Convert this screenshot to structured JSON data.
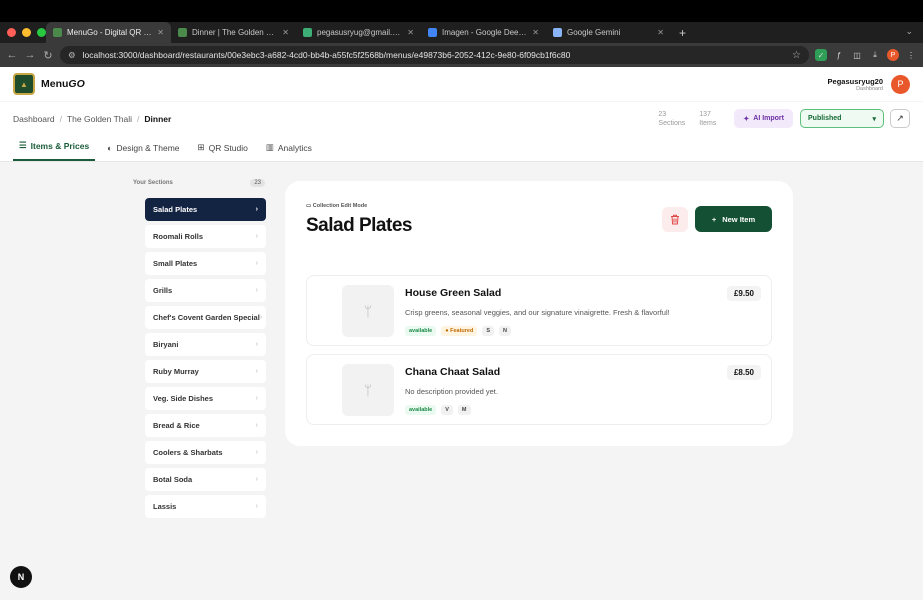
{
  "browser": {
    "tabs": [
      {
        "title": "MenuGo - Digital QR Code M",
        "active": true,
        "color": "#4b8a4b"
      },
      {
        "title": "Dinner | The Golden Thali - M",
        "active": false,
        "color": "#4b8a4b"
      },
      {
        "title": "pegasusryug@gmail.com's P",
        "active": false,
        "color": "#3cae76"
      },
      {
        "title": "Imagen - Google DeepMind",
        "active": false,
        "color": "#4285f4"
      },
      {
        "title": "Google Gemini",
        "active": false,
        "color": "#8ab4f8"
      }
    ],
    "url": "localhost:3000/dashboard/restaurants/00e3ebc3-a682-4cd0-bb4b-a55fc5f2568b/menus/e49873b6-2052-412c-9e80-6f09cb1f6c80",
    "profile_initial": "P"
  },
  "header": {
    "brand": "Menu",
    "brand_italic": "GO",
    "user_name": "Pegasusryug20",
    "user_sub": "Dashboard",
    "avatar_initial": "P"
  },
  "breadcrumb": {
    "items": [
      "Dashboard",
      "The Golden Thali"
    ],
    "current": "Dinner"
  },
  "stats": {
    "sections_count": "23",
    "sections_label": "Sections",
    "items_count": "137",
    "items_label": "Items"
  },
  "actions": {
    "ai_import": "AI Import",
    "status": "Published"
  },
  "nav_tabs": [
    {
      "label": "Items & Prices",
      "icon": "list-icon",
      "active": true
    },
    {
      "label": "Design & Theme",
      "icon": "palette-icon",
      "active": false
    },
    {
      "label": "QR Studio",
      "icon": "qr-icon",
      "active": false
    },
    {
      "label": "Analytics",
      "icon": "bar-chart-icon",
      "active": false
    }
  ],
  "sidebar": {
    "title": "Your Sections",
    "count": "23",
    "sections": [
      "Salad Plates",
      "Roomali Rolls",
      "Small Plates",
      "Grills",
      "Chef's Covent Garden Special",
      "Biryani",
      "Ruby Murray",
      "Veg. Side Dishes",
      "Bread & Rice",
      "Coolers & Sharbats",
      "Botal Soda",
      "Lassis"
    ],
    "active_index": 0
  },
  "collection": {
    "mode_label": "Collection Edit Mode",
    "title": "Salad Plates",
    "new_item_label": "New Item",
    "items": [
      {
        "name": "House Green Salad",
        "description": "Crisp greens, seasonal veggies, and our signature vinaigrette. Fresh & flavorful!",
        "price": "£9.50",
        "tags": [
          "available",
          "Featured",
          "S",
          "N"
        ]
      },
      {
        "name": "Chana Chaat Salad",
        "description": "No description provided yet.",
        "price": "£8.50",
        "tags": [
          "available",
          "V",
          "M"
        ]
      }
    ]
  },
  "footer": {
    "badge": "N"
  }
}
